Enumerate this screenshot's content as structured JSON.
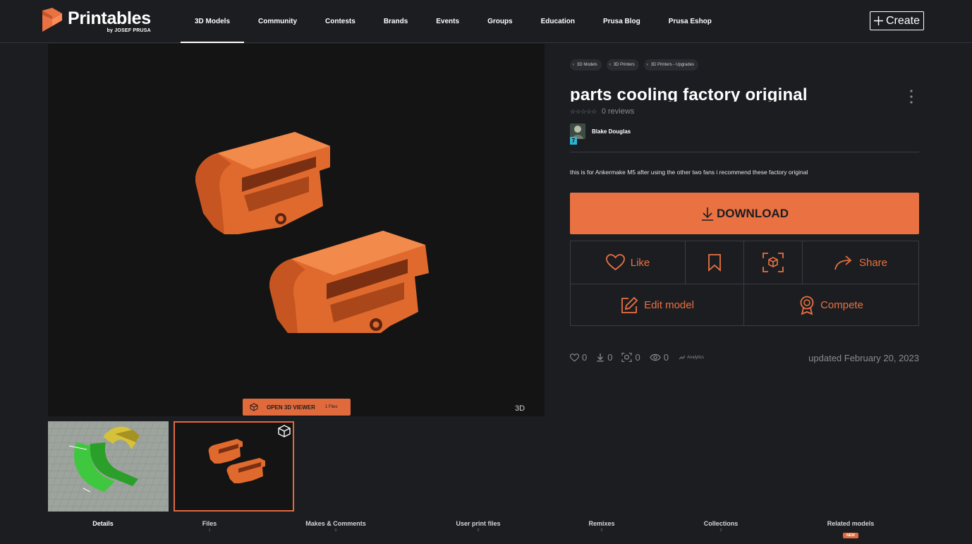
{
  "brand": {
    "name": "Printables",
    "byline": "by JOSEF PRUSA",
    "color": "#e97142"
  },
  "nav": {
    "items": [
      "3D Models",
      "Community",
      "Contests",
      "Brands",
      "Events",
      "Groups",
      "Education",
      "Prusa Blog",
      "Prusa Eshop"
    ],
    "active": "3D Models",
    "create_label": "Create"
  },
  "viewer": {
    "open_label": "OPEN 3D VIEWER",
    "files_count": "1 Files",
    "badge_3d": "3D"
  },
  "thumbnails": [
    {
      "name": "slicer-preview",
      "selected": false
    },
    {
      "name": "3d-render",
      "selected": true
    }
  ],
  "tabs": [
    {
      "label": "Details",
      "count": "",
      "active": true
    },
    {
      "label": "Files",
      "count": "1"
    },
    {
      "label": "Makes & Comments",
      "count": "0"
    },
    {
      "label": "User print files",
      "count": "0"
    },
    {
      "label": "Remixes",
      "count": "0"
    },
    {
      "label": "Collections",
      "count": "0"
    },
    {
      "label": "Related models",
      "badge": "NEW"
    }
  ],
  "model": {
    "breadcrumbs": [
      "3D Models",
      "3D Printers",
      "3D Printers - Upgrades"
    ],
    "title": "parts cooling factory original",
    "stars": "☆☆☆☆☆",
    "reviews": "0 reviews",
    "author": {
      "name": "Blake Douglas",
      "level": "7"
    },
    "description": "this is for Ankermake M5 after using the other two fans i recommend these factory original",
    "download_label": "DOWNLOAD",
    "actions": {
      "like": "Like",
      "share": "Share",
      "edit": "Edit model",
      "compete": "Compete"
    },
    "stats": {
      "likes": "0",
      "downloads": "0",
      "makes": "0",
      "views": "0",
      "analytics": "Analytics"
    },
    "updated": "updated February 20, 2023"
  }
}
